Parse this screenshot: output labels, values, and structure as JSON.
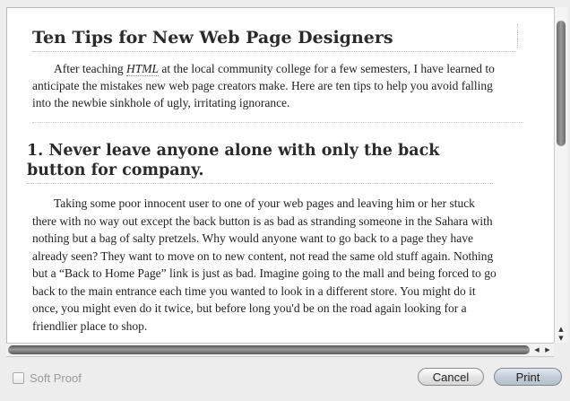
{
  "document": {
    "title": "Ten Tips for New Web Page Designers",
    "intro_before": "After teaching ",
    "intro_em": "HTML",
    "intro_after": " at the local community college for a few semesters, I have learned to anticipate the mistakes new web page creators make. Here are ten tips to help you avoid falling into the newbie sinkhole of ugly, irritating ignorance.",
    "tip1_heading": "1. Never leave anyone alone with only the back button for company.",
    "tip1_body": "Taking some poor innocent user to one of your web pages and leaving him or her stuck there with no way out except the back button is as bad as stranding someone in the Sahara with nothing but a bag of salty pretzels. Why would anyone want to go back to a page they have already seen? They want to move on to new content, not read the same old stuff again. Nothing but a “Back to Home Page” link is just as bad. Imagine going to the mall and being forced to go back to the main entrance each time you wanted to look in a different store. You might do it once, you might even do it twice, but before long you'd be on the road again looking for a friendlier place to shop."
  },
  "footer": {
    "soft_proof_label": "Soft Proof",
    "soft_proof_checked": false,
    "cancel_label": "Cancel",
    "print_label": "Print"
  },
  "scroll": {
    "up_arrow": "▲",
    "down_arrow": "▼",
    "left_arrow": "◀",
    "right_arrow": "▶"
  },
  "colors": {
    "page": "#ffffff",
    "window": "#ededed",
    "default_button": "#c2ccd6",
    "disabled_text": "#9a9a9a"
  }
}
